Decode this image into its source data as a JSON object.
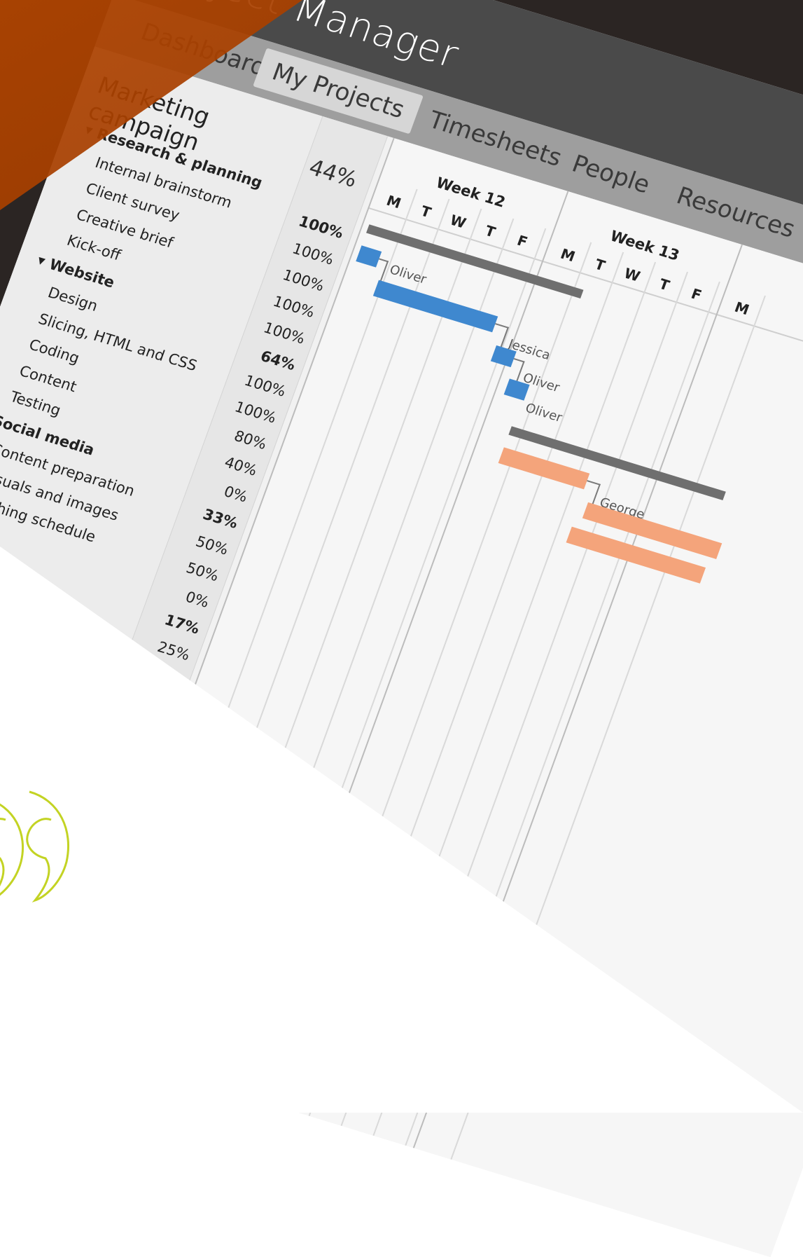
{
  "app": {
    "title": "Project Manager",
    "nav": [
      "Dashboard",
      "My Projects",
      "Timesheets",
      "People",
      "Resources"
    ],
    "active_nav": "My Projects"
  },
  "project": {
    "name": "Marketing campaign",
    "pct": "44%"
  },
  "tasks": [
    {
      "label": "Research & planning",
      "group": true
    },
    {
      "label": "Internal brainstorm",
      "group": false
    },
    {
      "label": "Client survey",
      "group": false
    },
    {
      "label": "Creative brief",
      "group": false
    },
    {
      "label": "Kick-off",
      "group": false
    },
    {
      "label": "Website",
      "group": true
    },
    {
      "label": "Design",
      "group": false
    },
    {
      "label": "Slicing, HTML and CSS",
      "group": false
    },
    {
      "label": "Coding",
      "group": false
    },
    {
      "label": "Content",
      "group": false
    },
    {
      "label": "Testing",
      "group": false
    },
    {
      "label": "Social media",
      "group": true
    },
    {
      "label": "Content preparation",
      "group": false
    },
    {
      "label": "Visuals and images",
      "group": false
    },
    {
      "label": "blishing schedule",
      "group": false
    }
  ],
  "pcts": [
    {
      "value": "100%",
      "bold": true
    },
    {
      "value": "100%",
      "bold": false
    },
    {
      "value": "100%",
      "bold": false
    },
    {
      "value": "100%",
      "bold": false
    },
    {
      "value": "100%",
      "bold": false
    },
    {
      "value": "64%",
      "bold": true
    },
    {
      "value": "100%",
      "bold": false
    },
    {
      "value": "100%",
      "bold": false
    },
    {
      "value": "80%",
      "bold": false
    },
    {
      "value": "40%",
      "bold": false
    },
    {
      "value": "0%",
      "bold": false
    },
    {
      "value": "33%",
      "bold": true
    },
    {
      "value": "50%",
      "bold": false
    },
    {
      "value": "50%",
      "bold": false
    },
    {
      "value": "0%",
      "bold": false
    },
    {
      "value": "17%",
      "bold": true
    },
    {
      "value": "25%",
      "bold": false
    }
  ],
  "timeline": {
    "weeks": [
      "Week 12",
      "Week 13"
    ],
    "days": [
      "M",
      "T",
      "W",
      "T",
      "F",
      "M",
      "T",
      "W",
      "T",
      "F",
      "M"
    ]
  },
  "assignees": [
    "Oliver",
    "Jessica",
    "Oliver",
    "Oliver",
    "George"
  ],
  "colors": {
    "titlebar": "#4a4a4a",
    "accent_orange": "#b14400",
    "bar_blue": "#3f88cf",
    "bar_orange": "#f4a47b",
    "bar_summary": "#6f6f6f",
    "quote_mark": "#c3d323"
  },
  "icons": {
    "expand": "caret-down-icon",
    "quote": "closing-quote-icon"
  }
}
